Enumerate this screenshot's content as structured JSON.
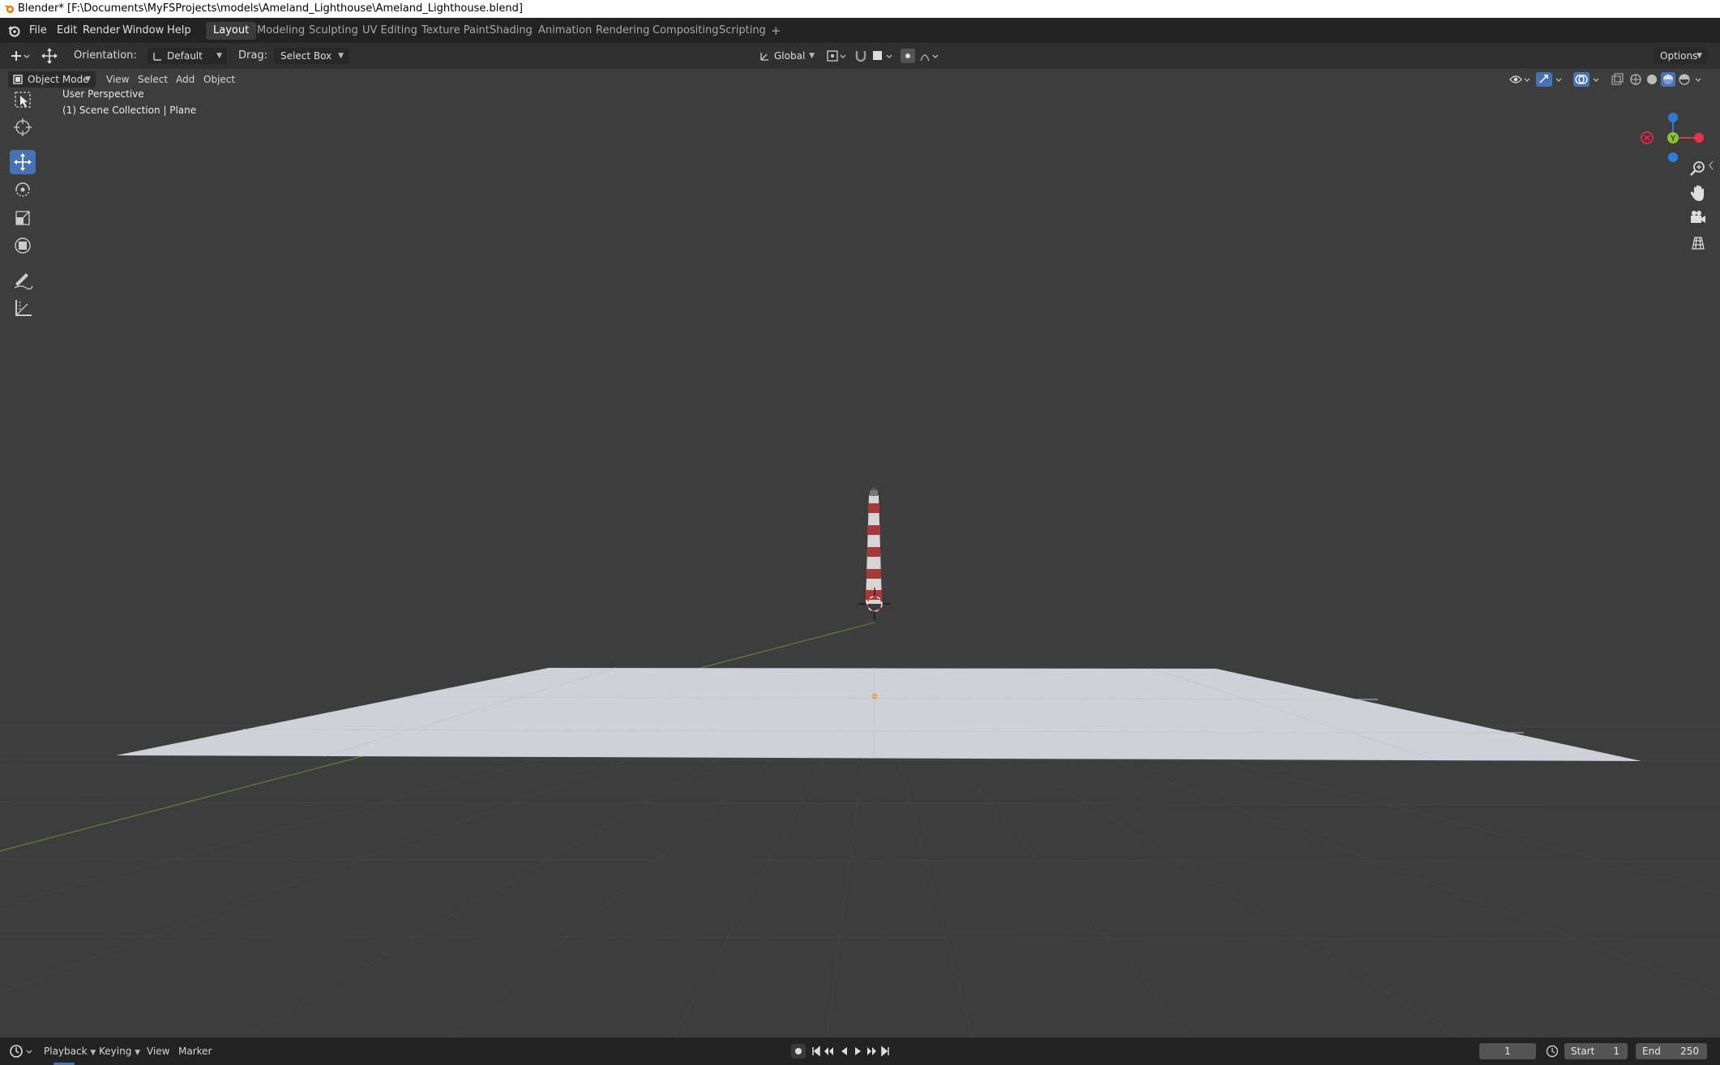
{
  "titlebar": {
    "title": "Blender* [F:\\Documents\\MyFSProjects\\models\\Ameland_Lighthouse\\Ameland_Lighthouse.blend]"
  },
  "menubar": {
    "menus": [
      "File",
      "Edit",
      "Render",
      "Window",
      "Help"
    ],
    "workspaces": [
      "Layout",
      "Modeling",
      "Sculpting",
      "UV Editing",
      "Texture Paint",
      "Shading",
      "Animation",
      "Rendering",
      "Compositing",
      "Scripting"
    ],
    "active_workspace": "Layout",
    "add_tab": "+"
  },
  "toolheader": {
    "orientation_label": "Orientation:",
    "orientation_value": "Default",
    "drag_label": "Drag:",
    "drag_value": "Select Box",
    "transform_orientation": "Global",
    "options_label": "Options"
  },
  "viewheader": {
    "mode": "Object Mode",
    "menus": [
      "View",
      "Select",
      "Add",
      "Object"
    ]
  },
  "viewport": {
    "perspective": "User Perspective",
    "collection": "(1) Scene Collection | Plane",
    "gizmo_y_label": "Y"
  },
  "timeline": {
    "menus": [
      "Playback",
      "Keying",
      "View",
      "Marker"
    ],
    "current_frame": "1",
    "start_label": "Start",
    "start_value": "1",
    "end_label": "End",
    "end_value": "250"
  },
  "colors": {
    "accent": "#4772b3",
    "x_axis": "#e8334d",
    "y_axis": "#8ac531",
    "z_axis": "#2b7fe0"
  }
}
